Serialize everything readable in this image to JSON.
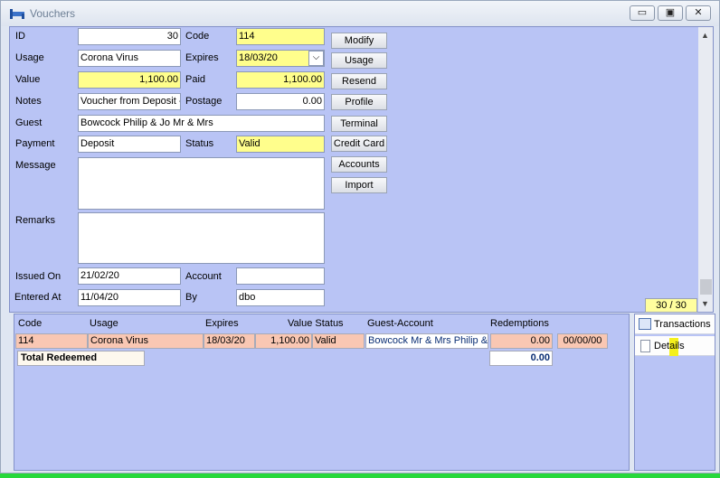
{
  "window": {
    "title": "Vouchers",
    "buttons": {
      "minimize": "▭",
      "restore": "▣",
      "close": "✕"
    }
  },
  "form": {
    "id": {
      "label": "ID",
      "value": "30"
    },
    "code": {
      "label": "Code",
      "value": "114"
    },
    "usage": {
      "label": "Usage",
      "value": "Corona Virus"
    },
    "expires": {
      "label": "Expires",
      "value": "18/03/20"
    },
    "value": {
      "label": "Value",
      "value": "1,100.00"
    },
    "paid": {
      "label": "Paid",
      "value": "1,100.00"
    },
    "notes": {
      "label": "Notes",
      "value": "Voucher from Deposit -"
    },
    "postage": {
      "label": "Postage",
      "value": "0.00"
    },
    "guest": {
      "label": "Guest",
      "value": "Bowcock Philip & Jo Mr & Mrs"
    },
    "payment": {
      "label": "Payment",
      "value": "Deposit"
    },
    "status": {
      "label": "Status",
      "value": "Valid"
    },
    "message": {
      "label": "Message",
      "value": ""
    },
    "remarks": {
      "label": "Remarks",
      "value": ""
    },
    "issued_on": {
      "label": "Issued On",
      "value": "21/02/20"
    },
    "account": {
      "label": "Account",
      "value": ""
    },
    "entered_at": {
      "label": "Entered At",
      "value": "11/04/20"
    },
    "by": {
      "label": "By",
      "value": "dbo"
    }
  },
  "actions": [
    "Modify",
    "Usage",
    "Resend",
    "Profile",
    "Terminal",
    "Credit Card",
    "Accounts",
    "Import"
  ],
  "pager": "30 / 30",
  "grid": {
    "headers": {
      "code": "Code",
      "usage": "Usage",
      "expires": "Expires",
      "value_status": "Value Status",
      "guest_account": "Guest-Account",
      "redemptions": "Redemptions"
    },
    "row": {
      "code": "114",
      "usage": "Corona Virus",
      "expires": "18/03/20",
      "value": "1,100.00",
      "status": "Valid",
      "guest": "Bowcock  Mr & Mrs Philip & J",
      "redemptions": "0.00",
      "date": "00/00/00"
    },
    "total": {
      "label": "Total Redeemed",
      "value": "0.00"
    }
  },
  "side_tabs": {
    "transactions": "Transactions",
    "details": "Details"
  },
  "colors": {
    "panel": "#b9c4f5",
    "highlight_field": "#fffe8c",
    "row": "#f9c7b3",
    "status_bar": "#27d83b"
  }
}
